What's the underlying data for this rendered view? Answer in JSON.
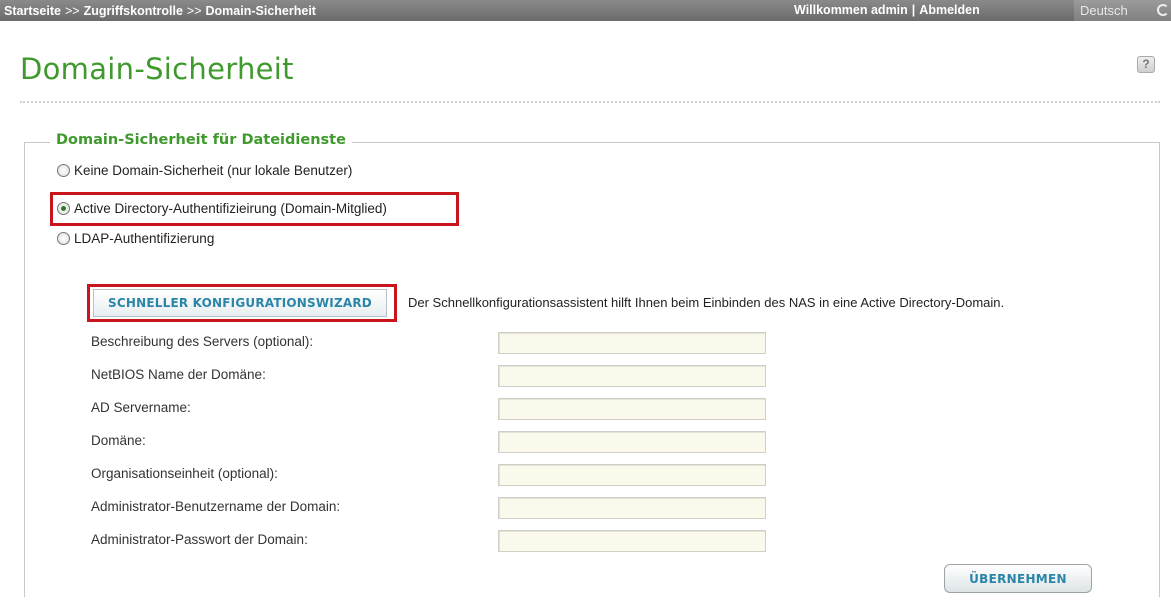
{
  "topbar": {
    "breadcrumb": [
      "Startseite",
      "Zugriffskontrolle",
      "Domain-Sicherheit"
    ],
    "separator": ">>",
    "welcome": "Willkommen admin",
    "logout": "Abmelden",
    "language": "Deutsch"
  },
  "page": {
    "title": "Domain-Sicherheit",
    "help_icon": "?"
  },
  "section": {
    "legend": "Domain-Sicherheit für Dateidienste",
    "options": [
      {
        "label": "Keine Domain-Sicherheit (nur lokale Benutzer)",
        "checked": false
      },
      {
        "label": "Active Directory-Authentifizieirung (Domain-Mitglied)",
        "checked": true
      },
      {
        "label": "LDAP-Authentifizierung",
        "checked": false
      }
    ]
  },
  "wizard": {
    "button_label": "SCHNELLER KONFIGURATIONSWIZARD",
    "description": "Der Schnellkonfigurationsassistent hilft Ihnen beim Einbinden des NAS in eine Active Directory-Domain."
  },
  "form": {
    "fields": [
      {
        "label": "Beschreibung des Servers (optional):",
        "value": ""
      },
      {
        "label": "NetBIOS Name der Domäne:",
        "value": ""
      },
      {
        "label": "AD Servername:",
        "value": ""
      },
      {
        "label": "Domäne:",
        "value": ""
      },
      {
        "label": "Organisationseinheit (optional):",
        "value": ""
      },
      {
        "label": "Administrator-Benutzername der Domain:",
        "value": ""
      },
      {
        "label": "Administrator-Passwort der Domain:",
        "value": ""
      }
    ]
  },
  "apply_button": "ÜBERNEHMEN",
  "colors": {
    "accent_green": "#3f9a2d",
    "highlight_red": "#c8151b",
    "button_text_blue": "#2a85a8",
    "topbar_gray": "#6b6b6b",
    "input_bg": "#fbf9ec"
  }
}
